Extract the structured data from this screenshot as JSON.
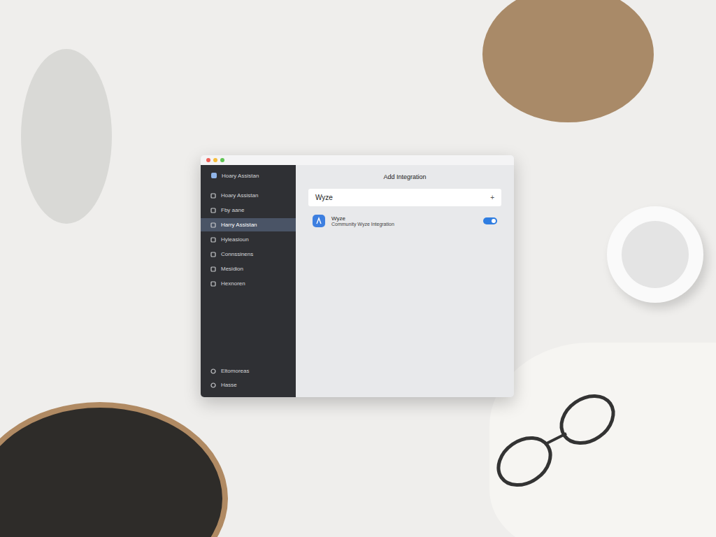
{
  "window": {
    "title": "Hoary Assistan"
  },
  "sidebar": {
    "items": [
      {
        "label": "Hoary Assistan",
        "selected": false
      },
      {
        "label": "Fby aane",
        "selected": false
      },
      {
        "label": "Harry Assistan",
        "selected": true
      },
      {
        "label": "Hyleasioun",
        "selected": false
      },
      {
        "label": "Connssinens",
        "selected": false
      },
      {
        "label": "Mesidion",
        "selected": false
      },
      {
        "label": "Hexnoren",
        "selected": false
      }
    ],
    "footer": [
      "Eltomoreas",
      "Hasse"
    ]
  },
  "main": {
    "title": "Add Integration",
    "search": {
      "value": "Wyze",
      "icon": "+"
    },
    "results": [
      {
        "name": "Wyze",
        "description": "Community Wyze Integration",
        "on": true
      }
    ]
  }
}
